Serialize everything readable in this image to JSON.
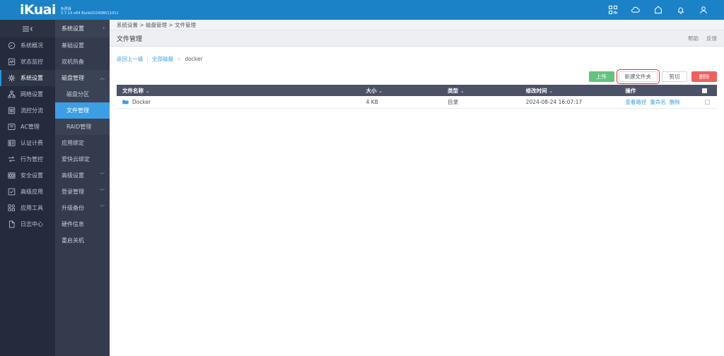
{
  "topbar": {
    "brand": "iKuai",
    "edition": "免费版",
    "version": "3.7.14 x64 Build202408011011",
    "icons": [
      {
        "name": "apps-grid-icon"
      },
      {
        "name": "cloud-icon"
      },
      {
        "name": "home-icon"
      },
      {
        "name": "bell-icon"
      },
      {
        "name": "user-icon"
      }
    ]
  },
  "sidebar_primary": {
    "collapse_label": "",
    "items": [
      {
        "label": "系统概况",
        "icon": "gauge-icon",
        "active": false
      },
      {
        "label": "状态监控",
        "icon": "monitor-icon",
        "active": false
      },
      {
        "label": "系统设置",
        "icon": "gear-icon",
        "active": true
      },
      {
        "label": "网络设置",
        "icon": "network-icon",
        "active": false
      },
      {
        "label": "流控分流",
        "icon": "sliders-icon",
        "active": false
      },
      {
        "label": "AC管理",
        "icon": "ac-icon",
        "active": false
      },
      {
        "label": "认证计费",
        "icon": "billing-icon",
        "active": false
      },
      {
        "label": "行为管控",
        "icon": "exchange-icon",
        "active": false
      },
      {
        "label": "安全设置",
        "icon": "firewall-icon",
        "active": false
      },
      {
        "label": "高级应用",
        "icon": "check-square-icon",
        "active": false
      },
      {
        "label": "应用工具",
        "icon": "tools-icon",
        "active": false
      },
      {
        "label": "日志中心",
        "icon": "file-icon",
        "active": false
      }
    ]
  },
  "sidebar_secondary": {
    "header": "系统设置",
    "items": [
      {
        "label": "基础设置",
        "type": "item"
      },
      {
        "label": "双机热备",
        "type": "item"
      },
      {
        "label": "磁盘管理",
        "type": "group",
        "expanded": true,
        "chevron": "︿"
      },
      {
        "label": "磁盘分区",
        "type": "sub",
        "active": false
      },
      {
        "label": "文件管理",
        "type": "sub",
        "active": true
      },
      {
        "label": "RAID管理",
        "type": "sub",
        "active": false
      },
      {
        "label": "应用绑定",
        "type": "item"
      },
      {
        "label": "爱快云绑定",
        "type": "item"
      },
      {
        "label": "高级设置",
        "type": "group",
        "expanded": false,
        "chevron": "﹀"
      },
      {
        "label": "登录管理",
        "type": "group",
        "expanded": false,
        "chevron": "﹀"
      },
      {
        "label": "升级备份",
        "type": "group",
        "expanded": false,
        "chevron": "﹀"
      },
      {
        "label": "硬件信息",
        "type": "item"
      },
      {
        "label": "重启关机",
        "type": "item"
      }
    ]
  },
  "breadcrumb": {
    "items": [
      "系统设置",
      "磁盘管理",
      "文件管理"
    ],
    "separator": ">",
    "text": "系统设置 > 磁盘管理 > 文件管理"
  },
  "page": {
    "title": "文件管理",
    "help_label": "帮助",
    "feedback_label": "反馈"
  },
  "path_nav": {
    "back_label": "返回上一级",
    "divider": "|",
    "root_label": "全部磁盘",
    "separator": ">",
    "current": "docker"
  },
  "toolbar": {
    "upload_label": "上传",
    "new_folder_label": "新建文件夹",
    "cut_label": "剪切",
    "delete_label": "删除",
    "highlight_color": "#F02B2B",
    "highlighted_button": "新建文件夹"
  },
  "table": {
    "columns": [
      {
        "key": "name",
        "label": "文件名称",
        "sortable": true
      },
      {
        "key": "size",
        "label": "大小",
        "sortable": true
      },
      {
        "key": "type",
        "label": "类型",
        "sortable": true
      },
      {
        "key": "mtime",
        "label": "修改时间",
        "sortable": true
      },
      {
        "key": "actions",
        "label": "操作",
        "sortable": false
      },
      {
        "key": "check",
        "label": "",
        "sortable": false
      }
    ],
    "sort_glyph": "⌄",
    "rows": [
      {
        "name": "Docker",
        "icon": "folder-icon",
        "size": "4 KB",
        "type": "目录",
        "mtime": "2024-08-24 16:07:17",
        "actions": [
          "查看路径",
          "重命名",
          "删除"
        ],
        "checked": false
      }
    ]
  },
  "colors": {
    "topbar": "#1B82C8",
    "sidebar_primary": "#242B3C",
    "sidebar_secondary": "#333B4D",
    "active_menu": "#3C9EE5",
    "table_header": "#4B5167",
    "green": "#63C47D",
    "red": "#F1605C",
    "link": "#3C9EE5"
  }
}
